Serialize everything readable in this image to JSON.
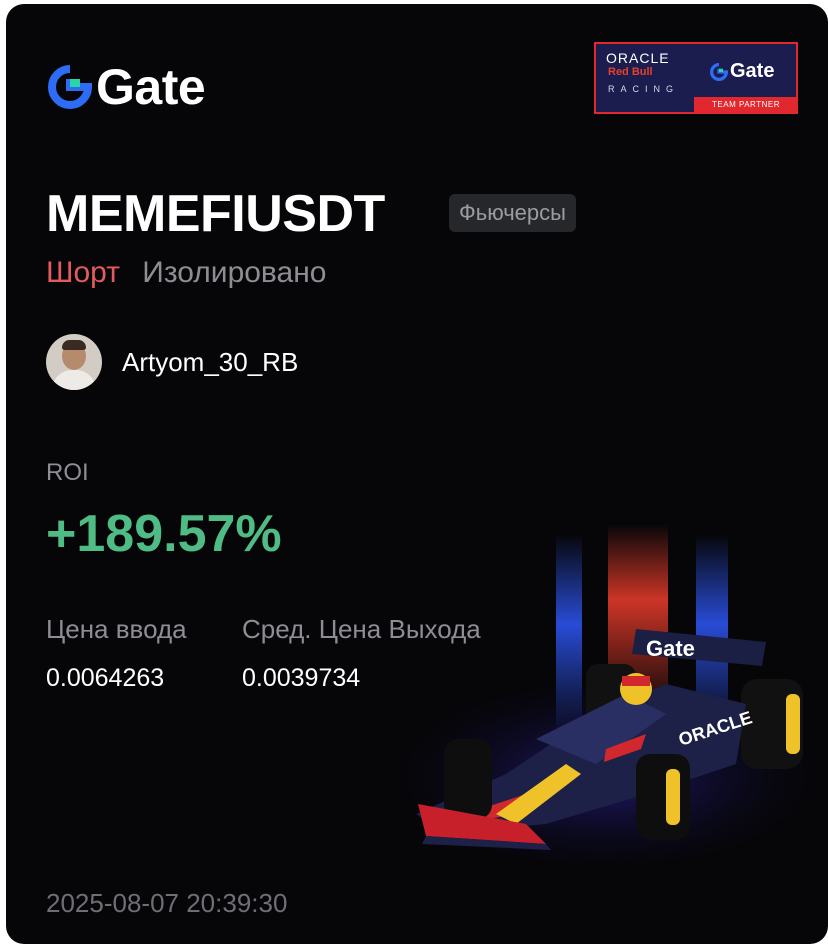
{
  "brand": {
    "logo_text": "Gate",
    "logo_icon": "gate-logo-icon",
    "colors": {
      "background": "#060608",
      "accent_blue": "#2d6df6",
      "short_red": "#e35a5f",
      "roi_green": "#4fbc85"
    }
  },
  "partner_badge": {
    "line1": "ORACLE",
    "line2": "Red Bull",
    "line3": "RACING",
    "gate_text": "Gate",
    "partner_label": "TEAM PARTNER"
  },
  "position": {
    "pair": "MEMEFIUSDT",
    "market_badge": "Фьючерсы",
    "side": "Шорт",
    "margin_mode": "Изолировано"
  },
  "user": {
    "name": "Artyom_30_RB"
  },
  "roi": {
    "label": "ROI",
    "value": "+189.57%"
  },
  "prices": {
    "entry_label": "Цена ввода",
    "entry_value": "0.0064263",
    "exit_label": "Сред. Цена Выхода",
    "exit_value": "0.0039734"
  },
  "timestamp": "2025-08-07 20:39:30",
  "car_livery": {
    "wing_text": "Gate",
    "sidepod_text": "ORACLE"
  }
}
